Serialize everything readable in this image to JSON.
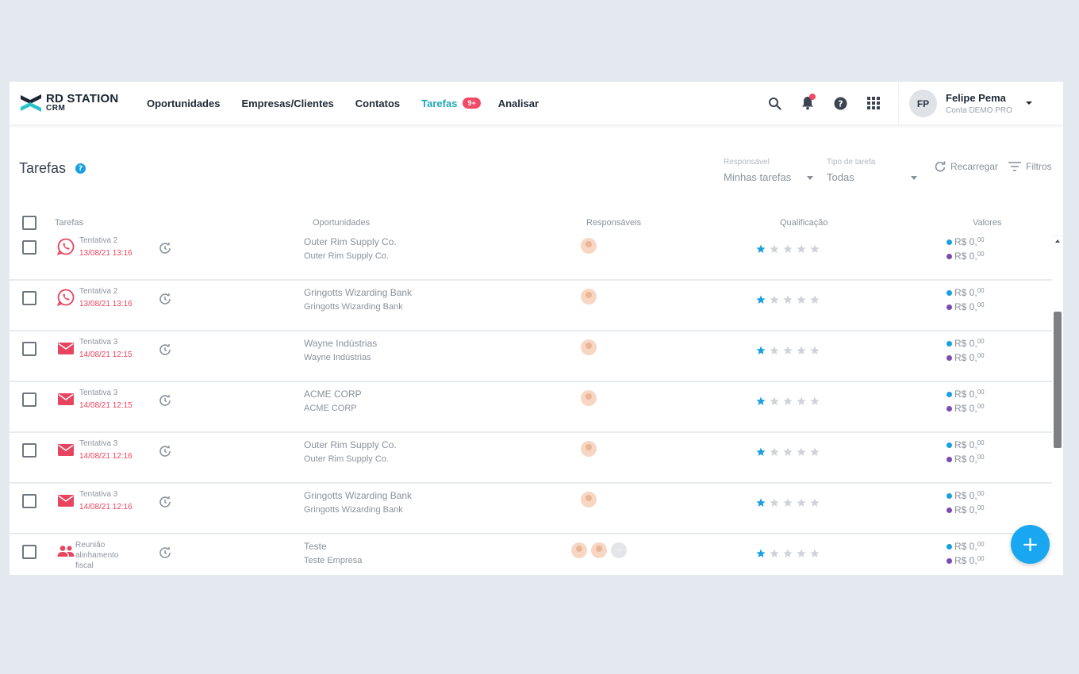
{
  "logo": {
    "line1": "RD STATION",
    "line2": "CRM",
    "icon": "rd-station-logo-icon"
  },
  "nav": {
    "items": [
      {
        "label": "Oportunidades"
      },
      {
        "label": "Empresas/Clientes"
      },
      {
        "label": "Contatos"
      },
      {
        "label": "Tarefas",
        "badge": "9+",
        "active": true
      },
      {
        "label": "Analisar"
      }
    ]
  },
  "header_icons": [
    "search-icon",
    "bell-icon",
    "help-icon",
    "apps-grid-icon"
  ],
  "user": {
    "initials": "FP",
    "name": "Felipe Pema",
    "account": "Conta DEMO PRO"
  },
  "page": {
    "title": "Tarefas",
    "help": "?",
    "responsavel": {
      "label": "Responsável",
      "value": "Minhas tarefas"
    },
    "tipo": {
      "label": "Tipo de tarefa",
      "value": "Todas"
    },
    "reload_label": "Recarregar",
    "filters_label": "Filtros"
  },
  "table": {
    "headers": {
      "tarefas": "Tarefas",
      "oportunidades": "Oportunidades",
      "responsaveis": "Responsáveis",
      "qualificacao": "Qualificação",
      "valores": "Valores"
    },
    "rows": [
      {
        "type": "whatsapp",
        "task": "Tentativa 2",
        "date": "13/08/21 13:16",
        "opp": "Outer Rim Supply Co.",
        "company": "Outer Rim Supply Co.",
        "responsibles": 1,
        "rating": 1,
        "value1": "R$ 0,",
        "value2": "R$ 0,",
        "cents": "00"
      },
      {
        "type": "whatsapp",
        "task": "Tentativa 2",
        "date": "13/08/21 13:16",
        "opp": "Gringotts Wizarding Bank",
        "company": "Gringotts Wizarding Bank",
        "responsibles": 1,
        "rating": 1,
        "value1": "R$ 0,",
        "value2": "R$ 0,",
        "cents": "00"
      },
      {
        "type": "email",
        "task": "Tentativa 3",
        "date": "14/08/21 12:15",
        "opp": "Wayne Indústrias",
        "company": "Wayne Indústrias",
        "responsibles": 1,
        "rating": 1,
        "value1": "R$ 0,",
        "value2": "R$ 0,",
        "cents": "00"
      },
      {
        "type": "email",
        "task": "Tentativa 3",
        "date": "14/08/21 12:15",
        "opp": "ACME CORP",
        "company": "ACME CORP",
        "responsibles": 1,
        "rating": 1,
        "value1": "R$ 0,",
        "value2": "R$ 0,",
        "cents": "00"
      },
      {
        "type": "email",
        "task": "Tentativa 3",
        "date": "14/08/21 12:16",
        "opp": "Outer Rim Supply Co.",
        "company": "Outer Rim Supply Co.",
        "responsibles": 1,
        "rating": 1,
        "value1": "R$ 0,",
        "value2": "R$ 0,",
        "cents": "00"
      },
      {
        "type": "email",
        "task": "Tentativa 3",
        "date": "14/08/21 12:16",
        "opp": "Gringotts Wizarding Bank",
        "company": "Gringotts Wizarding Bank",
        "responsibles": 1,
        "rating": 1,
        "value1": "R$ 0,",
        "value2": "R$ 0,",
        "cents": "00"
      },
      {
        "type": "meeting",
        "task": "Reunião alinhamento fiscal",
        "date": "",
        "opp": "Teste",
        "company": "Teste Empresa",
        "responsibles": 2,
        "more": "···",
        "rating": 1,
        "value1": "R$ 0,",
        "value2": "R$ 0,",
        "cents": "00"
      }
    ]
  },
  "colors": {
    "accent": "#1ea7b5",
    "badge": "#f04a66",
    "star_on": "#1a9fe0",
    "star_off": "#cfd3d8",
    "dot1": "#1a9fe0",
    "dot2": "#7b4bb5",
    "fab": "#18a7f0"
  },
  "fab": {
    "label": "+"
  }
}
